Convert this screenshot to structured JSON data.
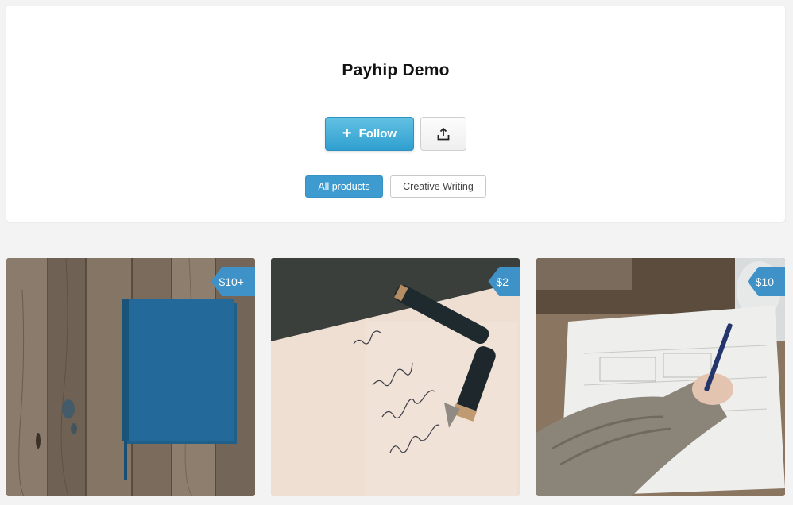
{
  "store": {
    "title": "Payhip Demo",
    "follow_label": "Follow",
    "follow_icon": "plus-icon",
    "share_icon": "share-upload-icon"
  },
  "filters": [
    {
      "label": "All products",
      "active": true
    },
    {
      "label": "Creative Writing",
      "active": false
    }
  ],
  "products": [
    {
      "price": "$10+",
      "image": "blue-notebook-on-wood"
    },
    {
      "price": "$2",
      "image": "fountain-pen-on-paper"
    },
    {
      "price": "$10",
      "image": "hand-writing-at-desk"
    }
  ],
  "colors": {
    "accent": "#3d9bd0",
    "price_tag": "#3e92c7",
    "background": "#f3f3f3"
  }
}
